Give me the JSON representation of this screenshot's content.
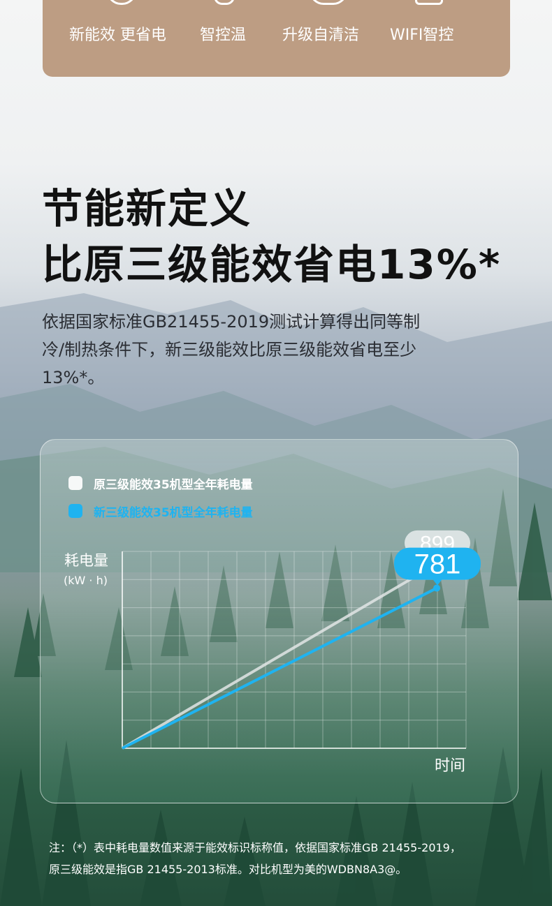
{
  "features": [
    {
      "label": "新能效 更省电",
      "icon": "energy-icon"
    },
    {
      "label": "智控温",
      "icon": "thermometer-icon"
    },
    {
      "label": "升级自清洁",
      "icon": "refresh-icon"
    },
    {
      "label": "WIFI智控",
      "icon": "wifi-icon"
    }
  ],
  "headline": {
    "line1": "节能新定义",
    "line2": "比原三级能效省电13%*"
  },
  "description": [
    "依据国家标准GB21455-2019测试计算得出同等制",
    "冷/制热条件下，新三级能效比原三级能效省电至少",
    "13%*。"
  ],
  "colors": {
    "feature_bar": "#bd9d83",
    "old_series": "#e2e6e6",
    "new_series": "#1fb3f0"
  },
  "chart_data": {
    "type": "line",
    "ylabel": "耗电量",
    "yunit": "(kW · h)",
    "xlabel": "时间",
    "series": [
      {
        "name": "原三级能效35机型全年耗电量",
        "start": 0,
        "end": 899,
        "end_label": "899"
      },
      {
        "name": "新三级能效35机型全年耗电量",
        "start": 0,
        "end": 781,
        "end_label": "781"
      }
    ],
    "ylim": [
      0,
      960
    ],
    "grid": true,
    "legend": "top-left"
  },
  "note": [
    "注：（*）表中耗电量数值来源于能效标识标称值，依据国家标准GB 21455-2019，",
    "原三级能效是指GB 21455-2013标准。对比机型为美的WDBN8A3@。"
  ]
}
